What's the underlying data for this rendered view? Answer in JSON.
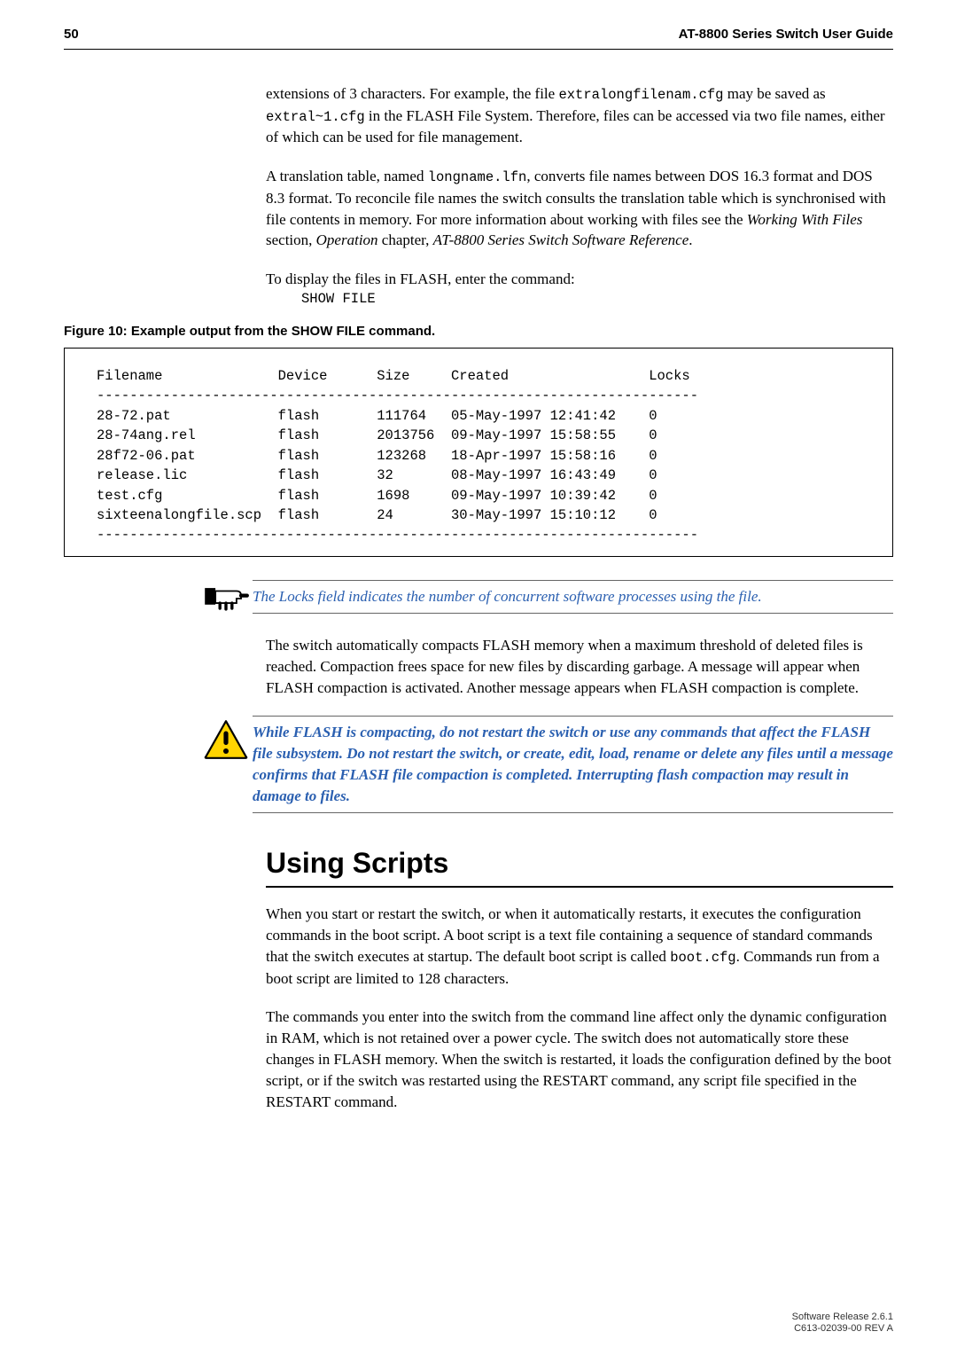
{
  "header": {
    "page_number": "50",
    "title": "AT-8800 Series Switch User Guide"
  },
  "intro_para1_pre": "extensions of 3 characters. For example, the file ",
  "intro_para1_code1": "extralongfilenam.cfg",
  "intro_para1_mid": " may be saved as ",
  "intro_para1_code2": "extral~1.cfg",
  "intro_para1_post": " in the FLASH File System. Therefore, files can be accessed via two file names, either of which can be used for file management.",
  "intro_para2_pre": "A translation table, named ",
  "intro_para2_code": "longname.lfn",
  "intro_para2_mid": ", converts file names between DOS 16.3 format and DOS 8.3 format. To reconcile file names the switch consults the translation table which is synchronised with file contents in memory. For more information about working with files see the ",
  "intro_para2_em1": "Working With Files",
  "intro_para2_mid2": " section, ",
  "intro_para2_em2": "Operation",
  "intro_para2_mid3": " chapter, ",
  "intro_para2_em3": "AT-8800 Series Switch Software Reference",
  "intro_para2_end": ".",
  "display_line": "To display the files in FLASH, enter the command:",
  "display_cmd": "SHOW FILE",
  "figure_caption": "Figure 10: Example output from the SHOW FILE command.",
  "file_table": {
    "headers": {
      "filename": "Filename",
      "device": "Device",
      "size": "Size",
      "created": "Created",
      "locks": "Locks"
    },
    "rows": [
      {
        "filename": "28-72.pat",
        "device": "flash",
        "size": "111764",
        "created": "05-May-1997 12:41:42",
        "locks": "0"
      },
      {
        "filename": "28-74ang.rel",
        "device": "flash",
        "size": "2013756",
        "created": "09-May-1997 15:58:55",
        "locks": "0"
      },
      {
        "filename": "28f72-06.pat",
        "device": "flash",
        "size": "123268",
        "created": "18-Apr-1997 15:58:16",
        "locks": "0"
      },
      {
        "filename": "release.lic",
        "device": "flash",
        "size": "32",
        "created": "08-May-1997 16:43:49",
        "locks": "0"
      },
      {
        "filename": "test.cfg",
        "device": "flash",
        "size": "1698",
        "created": "09-May-1997 10:39:42",
        "locks": "0"
      },
      {
        "filename": "sixteenalongfile.scp",
        "device": "flash",
        "size": "24",
        "created": "30-May-1997 15:10:12",
        "locks": "0"
      }
    ]
  },
  "locks_note": "The Locks field indicates the number of concurrent software processes using the file.",
  "compact_para": "The switch automatically compacts FLASH memory when a maximum threshold of deleted files is reached. Compaction frees space for new files by discarding garbage. A message will appear when FLASH compaction is activated. Another message appears when FLASH compaction is complete.",
  "warning_text": "While FLASH is compacting, do not restart the switch or use any commands that affect the FLASH file subsystem. Do not restart the switch, or create, edit, load, rename or delete any files until a message confirms that FLASH file compaction is completed. Interrupting flash compaction may result in damage to files.",
  "section_title": "Using Scripts",
  "scripts_para1_pre": "When you start or restart the switch, or when it automatically restarts, it executes the configuration commands in the boot script. A boot script is a text file containing a sequence of standard commands that the switch executes at startup. The default boot script is called ",
  "scripts_para1_code": "boot.cfg",
  "scripts_para1_post": ". Commands run from a boot script are limited to 128 characters.",
  "scripts_para2": "The commands you enter into the switch from the command line affect only the dynamic configuration in RAM, which is not retained over a power cycle. The switch does not automatically store these changes in FLASH memory. When the switch is restarted, it loads the configuration defined by the boot script, or if the switch was restarted using the RESTART command, any script file specified in the RESTART command.",
  "footer": {
    "line1": "Software Release 2.6.1",
    "line2": "C613-02039-00 REV A"
  },
  "chart_data": {
    "type": "table",
    "title": "Example output from the SHOW FILE command",
    "columns": [
      "Filename",
      "Device",
      "Size",
      "Created",
      "Locks"
    ],
    "rows": [
      [
        "28-72.pat",
        "flash",
        111764,
        "05-May-1997 12:41:42",
        0
      ],
      [
        "28-74ang.rel",
        "flash",
        2013756,
        "09-May-1997 15:58:55",
        0
      ],
      [
        "28f72-06.pat",
        "flash",
        123268,
        "18-Apr-1997 15:58:16",
        0
      ],
      [
        "release.lic",
        "flash",
        32,
        "08-May-1997 16:43:49",
        0
      ],
      [
        "test.cfg",
        "flash",
        1698,
        "09-May-1997 10:39:42",
        0
      ],
      [
        "sixteenalongfile.scp",
        "flash",
        24,
        "30-May-1997 15:10:12",
        0
      ]
    ]
  }
}
